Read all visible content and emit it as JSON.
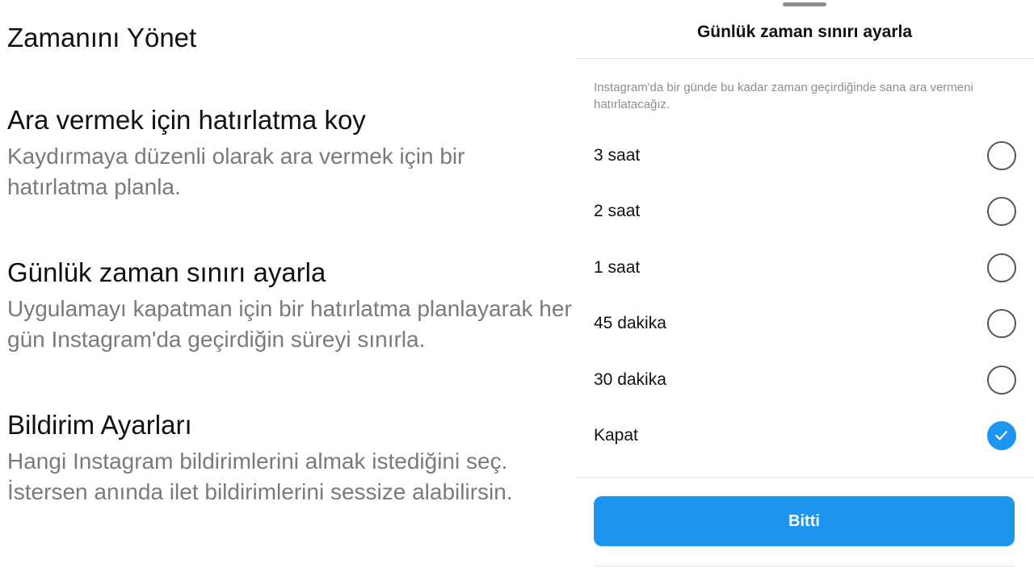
{
  "left_panel": {
    "title": "Zamanını Yönet",
    "sections": [
      {
        "title": "Ara vermek için hatırlatma koy",
        "description": "Kaydırmaya düzenli olarak ara vermek için bir hatırlatma planla."
      },
      {
        "title": "Günlük zaman sınırı ayarla",
        "description": "Uygulamayı kapatman için bir hatırlatma planlayarak her gün Instagram'da geçirdiğin süreyi sınırla."
      },
      {
        "title": "Bildirim Ayarları",
        "description": "Hangi Instagram bildirimlerini almak istediğini seç. İstersen anında ilet bildirimlerini sessize alabilirsin."
      }
    ]
  },
  "sheet": {
    "title": "Günlük zaman sınırı ayarla",
    "description": "Instagram'da bir günde bu kadar zaman geçirdiğinde sana ara vermeni hatırlatacağız.",
    "options": [
      {
        "label": "3 saat",
        "selected": false
      },
      {
        "label": "2 saat",
        "selected": false
      },
      {
        "label": "1 saat",
        "selected": false
      },
      {
        "label": "45 dakika",
        "selected": false
      },
      {
        "label": "30 dakika",
        "selected": false
      },
      {
        "label": "Kapat",
        "selected": true
      }
    ],
    "done_label": "Bitti"
  },
  "colors": {
    "accent": "#1c96ef",
    "secondary_text": "#7a7a7a"
  },
  "icons": {
    "selected": "checkmark-icon"
  }
}
